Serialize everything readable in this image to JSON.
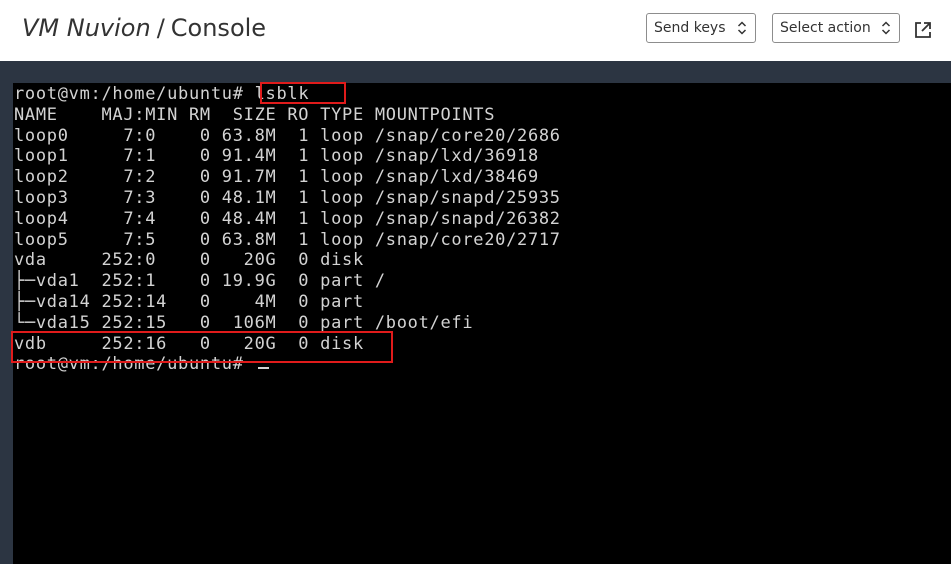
{
  "header": {
    "vm_name": "VM Nuvion",
    "separator": "/",
    "page": "Console"
  },
  "controls": {
    "send_keys_label": "Send keys",
    "select_action_label": "Select action",
    "external_icon": "external-link-icon",
    "chevron_icon": "chevron-up-down-icon"
  },
  "colors": {
    "terminal_bg": "#000000",
    "frame_bg": "#2c3542",
    "terminal_text": "#d3d3d3",
    "highlight": "#e01b1b"
  },
  "terminal": {
    "prompt": "root@vm:/home/ubuntu#",
    "command": "lsblk",
    "header": "NAME    MAJ:MIN RM  SIZE RO TYPE MOUNTPOINTS",
    "rows": [
      "loop0     7:0    0 63.8M  1 loop /snap/core20/2686",
      "loop1     7:1    0 91.4M  1 loop /snap/lxd/36918",
      "loop2     7:2    0 91.7M  1 loop /snap/lxd/38469",
      "loop3     7:3    0 48.1M  1 loop /snap/snapd/25935",
      "loop4     7:4    0 48.4M  1 loop /snap/snapd/26382",
      "loop5     7:5    0 63.8M  1 loop /snap/core20/2717",
      "vda     252:0    0   20G  0 disk",
      "├─vda1  252:1    0 19.9G  0 part /",
      "├─vda14 252:14   0    4M  0 part",
      "└─vda15 252:15   0  106M  0 part /boot/efi",
      "vdb     252:16   0   20G  0 disk"
    ],
    "final_prompt": "root@vm:/home/ubuntu#"
  }
}
